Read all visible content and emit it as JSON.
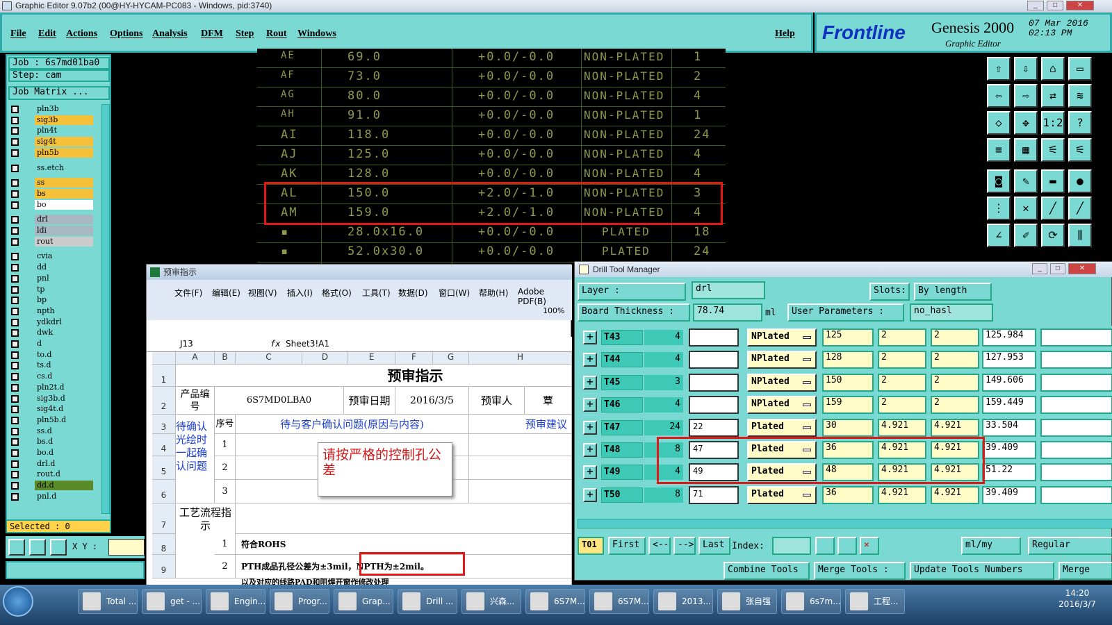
{
  "window_title": "Graphic Editor 9.07b2 (00@HY-HYCAM-PC083 - Windows, pid:3740)",
  "menu": [
    "File",
    "Edit",
    "Actions",
    "Options",
    "Analysis",
    "DFM",
    "Step",
    "Rout",
    "Windows"
  ],
  "help": "Help",
  "logo": {
    "brand": "Frontline",
    "product": "Genesis 2000",
    "subtitle": "Graphic Editor",
    "date": "07 Mar 2016",
    "time": "02:13 PM"
  },
  "left": {
    "job": "Job : 6s7md01ba0",
    "step": "Step: cam",
    "job_matrix": "Job Matrix ...",
    "selected": "Selected : 0",
    "xy": "X Y :",
    "layers": [
      {
        "name": "pln3b",
        "color": "#7ad9d3"
      },
      {
        "name": "sig3b",
        "color": "#f6c13a"
      },
      {
        "name": "pln4t",
        "color": "#7ad9d3"
      },
      {
        "name": "sig4t",
        "color": "#f6c13a"
      },
      {
        "name": "pln5b",
        "color": "#f6c13a"
      },
      {
        "name": "ss.etch",
        "color": "#7ad9d3"
      },
      {
        "name": "ss",
        "color": "#f6c13a"
      },
      {
        "name": "bs",
        "color": "#f6c13a"
      },
      {
        "name": "bo",
        "color": "#ffffff"
      },
      {
        "name": "drl",
        "color": "#a8b8c0"
      },
      {
        "name": "ldi",
        "color": "#a8b8c0"
      },
      {
        "name": "rout",
        "color": "#cccccc"
      },
      {
        "name": "cvia",
        "color": "#7ad9d3"
      },
      {
        "name": "dd",
        "color": "#7ad9d3"
      },
      {
        "name": "pnl",
        "color": "#7ad9d3"
      },
      {
        "name": "tp",
        "color": "#7ad9d3"
      },
      {
        "name": "bp",
        "color": "#7ad9d3"
      },
      {
        "name": "npth",
        "color": "#7ad9d3"
      },
      {
        "name": "ydkdrl",
        "color": "#7ad9d3"
      },
      {
        "name": "dwk",
        "color": "#7ad9d3"
      },
      {
        "name": "d",
        "color": "#7ad9d3"
      },
      {
        "name": "to.d",
        "color": "#7ad9d3"
      },
      {
        "name": "ts.d",
        "color": "#7ad9d3"
      },
      {
        "name": "cs.d",
        "color": "#7ad9d3"
      },
      {
        "name": "pln2t.d",
        "color": "#7ad9d3"
      },
      {
        "name": "sig3b.d",
        "color": "#7ad9d3"
      },
      {
        "name": "sig4t.d",
        "color": "#7ad9d3"
      },
      {
        "name": "pln5b.d",
        "color": "#7ad9d3"
      },
      {
        "name": "ss.d",
        "color": "#7ad9d3"
      },
      {
        "name": "bs.d",
        "color": "#7ad9d3"
      },
      {
        "name": "bo.d",
        "color": "#7ad9d3"
      },
      {
        "name": "drl.d",
        "color": "#7ad9d3"
      },
      {
        "name": "rout.d",
        "color": "#7ad9d3"
      },
      {
        "name": "dd.d",
        "color": "#5a8a2a"
      },
      {
        "name": "pnl.d",
        "color": "#7ad9d3"
      }
    ]
  },
  "canvas_rows": [
    {
      "id": "AE",
      "size": "69.0",
      "tol": "+0.0/-0.0",
      "type": "NON-PLATED",
      "count": "1"
    },
    {
      "id": "AF",
      "size": "73.0",
      "tol": "+0.0/-0.0",
      "type": "NON-PLATED",
      "count": "2"
    },
    {
      "id": "AG",
      "size": "80.0",
      "tol": "+0.0/-0.0",
      "type": "NON-PLATED",
      "count": "4"
    },
    {
      "id": "AH",
      "size": "91.0",
      "tol": "+0.0/-0.0",
      "type": "NON-PLATED",
      "count": "1"
    },
    {
      "id": "AI",
      "size": "118.0",
      "tol": "+0.0/-0.0",
      "type": "NON-PLATED",
      "count": "24"
    },
    {
      "id": "AJ",
      "size": "125.0",
      "tol": "+0.0/-0.0",
      "type": "NON-PLATED",
      "count": "4"
    },
    {
      "id": "AK",
      "size": "128.0",
      "tol": "+0.0/-0.0",
      "type": "NON-PLATED",
      "count": "4"
    },
    {
      "id": "AL",
      "size": "150.0",
      "tol": "+2.0/-1.0",
      "type": "NON-PLATED",
      "count": "3"
    },
    {
      "id": "AM",
      "size": "159.0",
      "tol": "+2.0/-1.0",
      "type": "NON-PLATED",
      "count": "4"
    },
    {
      "id": "▪",
      "size": "28.0x16.0",
      "tol": "+0.0/-0.0",
      "type": "PLATED",
      "count": "18"
    },
    {
      "id": "▪",
      "size": "52.0x30.0",
      "tol": "+0.0/-0.0",
      "type": "PLATED",
      "count": "24"
    }
  ],
  "excel": {
    "title": "预审指示",
    "menu": [
      "文件(F)",
      "编辑(E)",
      "视图(V)",
      "插入(I)",
      "格式(O)",
      "工具(T)",
      "数据(D)",
      "窗口(W)",
      "帮助(H)",
      "Adobe PDF(B)"
    ],
    "zoom": "100%",
    "cellref": "J13",
    "formula": "Sheet3!A1",
    "cols": [
      "A",
      "B",
      "C",
      "D",
      "E",
      "F",
      "G",
      "H"
    ],
    "product_label": "产品编号",
    "product": "6S7MD0LBA0",
    "date_label": "预审日期",
    "date": "2016/3/5",
    "reviewer_label": "预审人",
    "extra": "覃",
    "seq": "序号",
    "issue_header": "待与客户确认问题(原因与内容)",
    "suggest": "预审建议",
    "confirm_label": "待确认光绘时一起确认问题",
    "process_label": "工艺流程指示",
    "n1": "1",
    "n2": "2",
    "n3": "3",
    "rohs": "符合ROHS",
    "pth": "PTH成品孔径公差为±3mil，NPTH为±2mil。",
    "cut": "以及对应的线路PAD和阻焊开窗作修改处理",
    "comment": "请按严格的控制孔公差"
  },
  "dtm": {
    "title": "Drill Tool Manager",
    "layer_label": "Layer :",
    "layer": "drl",
    "slots_label": "Slots:",
    "slots": "By length",
    "thick_label": "Board Thickness :",
    "thick": "78.74",
    "thick_unit": "ml",
    "up_label": "User Parameters :",
    "up": "no_hasl",
    "rows": [
      {
        "name": "T43",
        "count": "4",
        "w": "",
        "type": "NPlated",
        "a": "125",
        "b": "2",
        "c": "2",
        "d": "125.984"
      },
      {
        "name": "T44",
        "count": "4",
        "w": "",
        "type": "NPlated",
        "a": "128",
        "b": "2",
        "c": "2",
        "d": "127.953"
      },
      {
        "name": "T45",
        "count": "3",
        "w": "",
        "type": "NPlated",
        "a": "150",
        "b": "2",
        "c": "2",
        "d": "149.606"
      },
      {
        "name": "T46",
        "count": "4",
        "w": "",
        "type": "NPlated",
        "a": "159",
        "b": "2",
        "c": "2",
        "d": "159.449"
      },
      {
        "name": "T47",
        "count": "24",
        "w": "22",
        "type": "Plated",
        "a": "30",
        "b": "4.921",
        "c": "4.921",
        "d": "33.504"
      },
      {
        "name": "T48",
        "count": "8",
        "w": "47",
        "type": "Plated",
        "a": "36",
        "b": "4.921",
        "c": "4.921",
        "d": "39.409"
      },
      {
        "name": "T49",
        "count": "4",
        "w": "49",
        "type": "Plated",
        "a": "48",
        "b": "4.921",
        "c": "4.921",
        "d": "51.22"
      },
      {
        "name": "T50",
        "count": "8",
        "w": "71",
        "type": "Plated",
        "a": "36",
        "b": "4.921",
        "c": "4.921",
        "d": "39.409"
      }
    ],
    "tool": "T01",
    "first": "First",
    "prev": "<--",
    "next": "-->",
    "last": "Last",
    "index": "Index:",
    "units": "ml/my",
    "mode": "Regular",
    "combine": "Combine Tools",
    "merge": "Merge Tools :",
    "update": "Update Tools Numbers",
    "merge2": "Merge"
  },
  "taskbar": {
    "items": [
      "Total ...",
      "get - ...",
      "Engin...",
      "Progr...",
      "Grap...",
      "Drill ...",
      "兴森...",
      "6S7M...",
      "6S7M...",
      "2013...",
      "张自强",
      "6s7m...",
      "工程..."
    ],
    "time": "14:20",
    "date": "2016/3/7"
  }
}
